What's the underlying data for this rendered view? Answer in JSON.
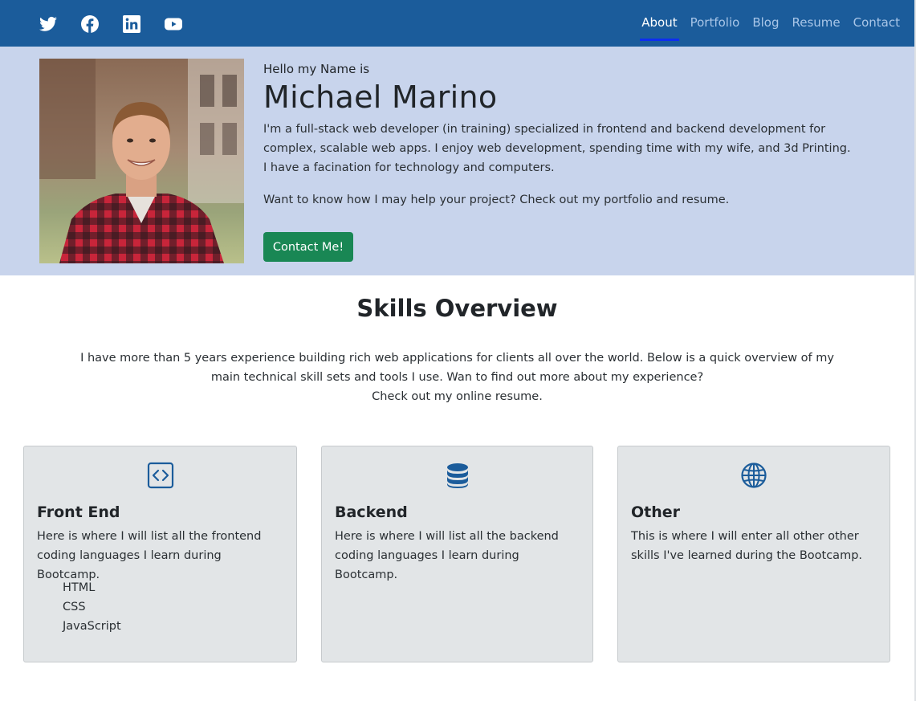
{
  "colors": {
    "navbar_bg": "#1b5c9b",
    "hero_bg": "#c8d4ec",
    "nav_active_underline": "#0d2ef0",
    "contact_button": "#198754",
    "card_bg": "#e2e5e7",
    "icon_blue": "#1b5c9b"
  },
  "navbar": {
    "social_icons": [
      "twitter-icon",
      "facebook-icon",
      "linkedin-icon",
      "youtube-icon"
    ],
    "links": [
      {
        "label": "About",
        "active": true
      },
      {
        "label": "Portfolio",
        "active": false
      },
      {
        "label": "Blog",
        "active": false
      },
      {
        "label": "Resume",
        "active": false
      },
      {
        "label": "Contact",
        "active": false
      }
    ]
  },
  "hero": {
    "greeting": "Hello my Name is",
    "name": "Michael Marino",
    "bio": "I'm a full-stack web developer (in training) specialized in frontend and backend development for complex, scalable web apps. I enjoy web development, spending time with my wife, and 3d Printing. I have a facination for technology and computers.",
    "cta_text": "Want to know how I may help your project? Check out my portfolio and resume.",
    "contact_button": "Contact Me!"
  },
  "skills": {
    "title": "Skills Overview",
    "intro_line1": "I have more than 5 years experience building rich web applications for clients all over the world. Below is a quick overview of my main technical skill sets and tools I use. Wan to find out more about my experience?",
    "intro_line2": "Check out my online resume.",
    "cards": [
      {
        "icon": "code-square-icon",
        "title": "Front End",
        "text": "Here is where I will list all the frontend coding languages I learn during Bootcamp.",
        "items": [
          "HTML",
          "CSS",
          "JavaScript"
        ]
      },
      {
        "icon": "database-icon",
        "title": "Backend",
        "text": "Here is where I will list all the backend coding languages I learn during Bootcamp."
      },
      {
        "icon": "globe-icon",
        "title": "Other",
        "text": "This is where I will enter all other other skills I've learned during the Bootcamp."
      }
    ]
  }
}
